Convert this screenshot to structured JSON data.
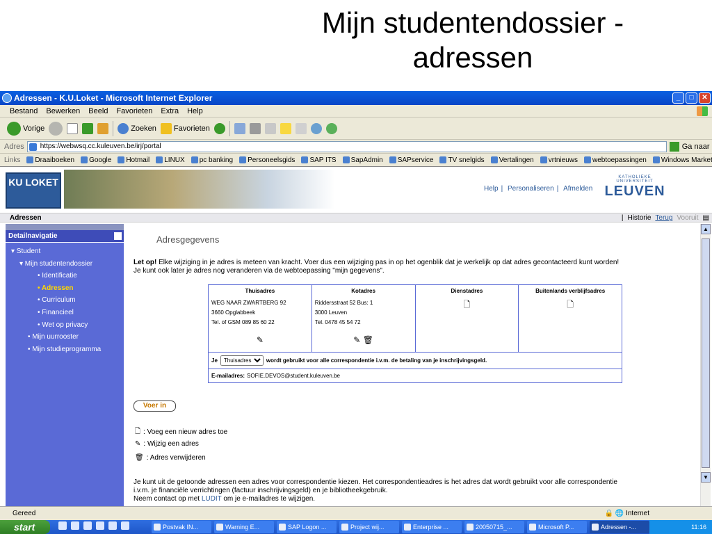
{
  "slide": {
    "title_line1": "Mijn studentendossier -",
    "title_line2": "adressen"
  },
  "window": {
    "title": "Adressen - K.U.Loket - Microsoft Internet Explorer",
    "btn_min": "_",
    "btn_max": "□",
    "btn_close": "✕"
  },
  "menu": [
    "Bestand",
    "Bewerken",
    "Beeld",
    "Favorieten",
    "Extra",
    "Help"
  ],
  "toolbar": {
    "back": "Vorige",
    "search": "Zoeken",
    "favorites": "Favorieten"
  },
  "address": {
    "label": "Adres",
    "url": "https://webwsq.cc.kuleuven.be/irj/portal",
    "go": "Ga naar"
  },
  "links": {
    "label": "Links",
    "items": [
      "Draaiboeken",
      "Google",
      "Hotmail",
      "LINUX",
      "pc banking",
      "Personeelsgids",
      "SAP ITS",
      "SapAdmin",
      "SAPservice",
      "TV snelgids",
      "Vertalingen",
      "vrtnieuws",
      "webtoepassingen",
      "Windows Marketplace"
    ]
  },
  "portal": {
    "logo": "KU LOKET",
    "header_links": [
      "Help",
      "Personaliseren",
      "Afmelden"
    ],
    "leuven_small": "KATHOLIEKE UNIVERSITEIT",
    "leuven_big": "LEUVEN",
    "page_name": "Adressen",
    "history": "Historie",
    "back": "Terug",
    "forward": "Vooruit"
  },
  "sidebar": {
    "header": "Detailnavigatie",
    "items": [
      "▾ Student",
      "▾ Mijn studentendossier",
      "• Identificatie",
      "• Adressen",
      "• Curriculum",
      "• Financieel",
      "• Wet op privacy",
      "• Mijn uurrooster",
      "• Mijn studieprogramma"
    ]
  },
  "main": {
    "heading": "Adresgegevens",
    "warn_bold": "Let op!",
    "warn_text": " Elke wijziging in je adres is meteen van kracht. Voer dus een wijziging pas in op het ogenblik dat je werkelijk op dat adres gecontacteerd kunt worden!",
    "warn_text2": "Je kunt ook later je adres nog veranderen via de webtoepassing \"mijn gegevens\".",
    "columns": [
      {
        "header": "Thuisadres",
        "lines": [
          "WEG NAAR ZWARTBERG 92",
          "3660 Opglabbeek",
          "Tel. of GSM 089 85 60 22"
        ]
      },
      {
        "header": "Kotadres",
        "lines": [
          "Riddersstraat 52  Bus: 1",
          "3000 Leuven",
          "Tel. 0478 45 54 72"
        ]
      },
      {
        "header": "Dienstadres",
        "lines": []
      },
      {
        "header": "Buitenlands verblijfsadres",
        "lines": []
      }
    ],
    "corr_prefix": "Je",
    "corr_selected": "Thuisadres",
    "corr_suffix": "wordt gebruikt voor alle correspondentie i.v.m. de betaling van je inschrijvingsgeld.",
    "email_label": "E-mailadres:",
    "email_value": "SOFIE.DEVOS@student.kuleuven.be",
    "submit": "Voer in",
    "legend": [
      ": Voeg een nieuw adres toe",
      ": Wijzig een adres",
      ": Adres verwijderen"
    ],
    "foot1": "Je kunt uit de getoonde adressen een adres voor correspondentie kiezen. Het correspondentieadres is het adres dat wordt gebruikt voor alle correspondentie",
    "foot2": "i.v.m. je financiële verrichtingen (factuur inschrijvingsgeld) en je bibliotheekgebruik.",
    "foot3_pre": "Neem contact op met ",
    "foot3_link": "LUDIT",
    "foot3_post": " om je e-mailadres te wijzigen."
  },
  "status": {
    "text": "Gereed",
    "zone": "Internet"
  },
  "taskbar": {
    "start": "start",
    "tasks": [
      "Postvak IN...",
      "Warning E...",
      "SAP Logon ...",
      "Project wij...",
      "Enterprise ...",
      "20050715_...",
      "Microsoft P...",
      "Adressen -..."
    ],
    "clock": "11:16"
  }
}
